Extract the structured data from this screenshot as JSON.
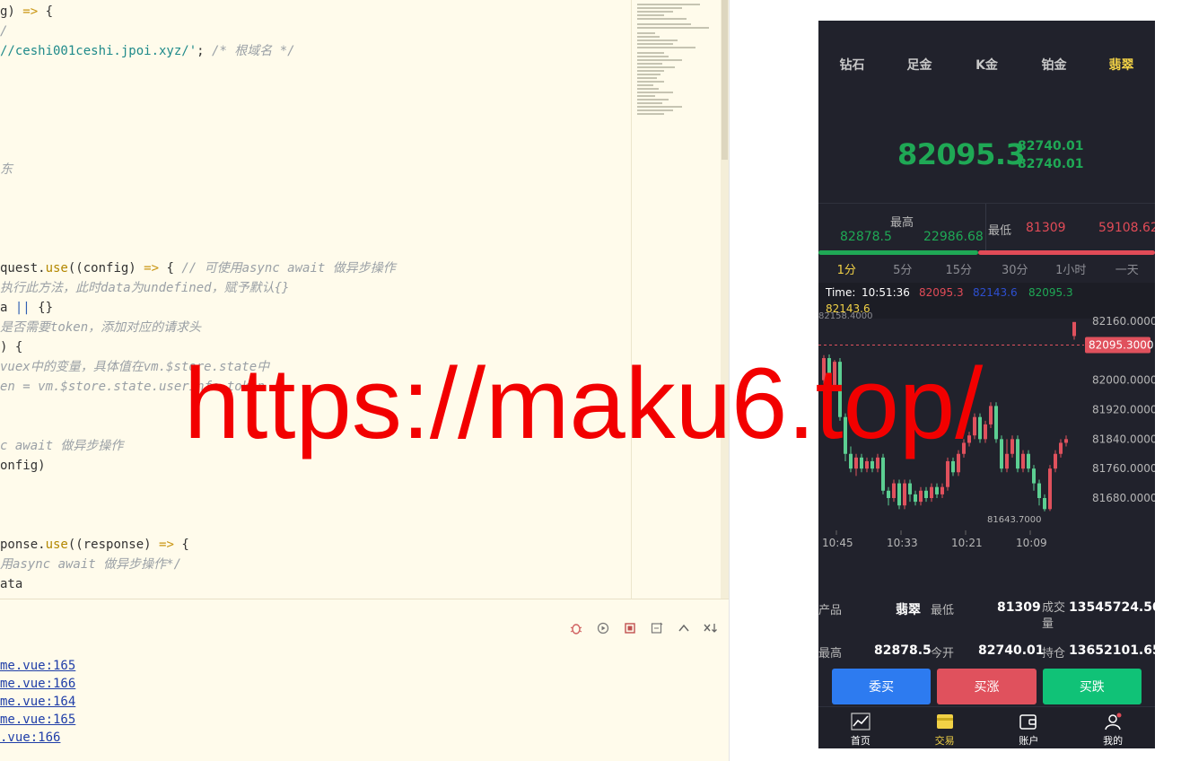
{
  "editor": {
    "lines": [
      {
        "top": 2,
        "parts": [
          [
            "",
            "g) "
          ],
          [
            "k",
            "=>"
          ],
          [
            "",
            " {"
          ]
        ]
      },
      {
        "top": 24,
        "parts": [
          [
            "c",
            "/"
          ]
        ]
      },
      {
        "top": 46,
        "parts": [
          [
            "s",
            "//ceshi001ceshi.jpoi.xyz/'"
          ],
          [
            "",
            "; "
          ],
          [
            "c",
            "/* 根域名 */"
          ]
        ]
      },
      {
        "top": 178,
        "parts": [
          [
            "c",
            "东"
          ]
        ]
      },
      {
        "top": 288,
        "parts": [
          [
            "",
            "quest."
          ],
          [
            "fn",
            "use"
          ],
          [
            "",
            "((config) "
          ],
          [
            "k",
            "=>"
          ],
          [
            "",
            " { "
          ],
          [
            "c",
            "// 可使用async await 做异步操作"
          ]
        ]
      },
      {
        "top": 310,
        "parts": [
          [
            "c",
            "执行此方法，此时data为undefined，赋予默认{}"
          ]
        ]
      },
      {
        "top": 332,
        "parts": [
          [
            "",
            "a "
          ],
          [
            "b",
            "||"
          ],
          [
            "",
            " {}"
          ]
        ]
      },
      {
        "top": 354,
        "parts": [
          [
            "c",
            "是否需要token，添加对应的请求头"
          ]
        ]
      },
      {
        "top": 376,
        "parts": [
          [
            "",
            ") {"
          ]
        ]
      },
      {
        "top": 398,
        "parts": [
          [
            "c",
            "vuex中的变量，具体值在vm.$store.state中"
          ]
        ]
      },
      {
        "top": 420,
        "parts": [
          [
            "c",
            "en = vm.$store.state.userInfo.token"
          ]
        ]
      },
      {
        "top": 486,
        "parts": [
          [
            "c",
            "c await 做异步操作"
          ]
        ]
      },
      {
        "top": 508,
        "parts": [
          [
            "",
            "onfig)"
          ]
        ]
      },
      {
        "top": 596,
        "parts": [
          [
            "",
            "ponse."
          ],
          [
            "fn",
            "use"
          ],
          [
            "",
            "((response) "
          ],
          [
            "k",
            "=>"
          ],
          [
            "",
            " {"
          ]
        ]
      },
      {
        "top": 618,
        "parts": [
          [
            "c",
            "用async await 做异步操作*/"
          ]
        ]
      },
      {
        "top": 640,
        "parts": [
          [
            "",
            "ata"
          ]
        ]
      }
    ]
  },
  "console": {
    "links": [
      {
        "text": "me.vue:165",
        "top": 731
      },
      {
        "text": "me.vue:166",
        "top": 751
      },
      {
        "text": "me.vue:164",
        "top": 771
      },
      {
        "text": "me.vue:165",
        "top": 791
      },
      {
        "text": ".vue:166",
        "top": 811
      }
    ]
  },
  "phone": {
    "tabs": [
      "钻石",
      "足金",
      "K金",
      "铂金",
      "翡翠"
    ],
    "active_tab": 4,
    "price": "82095.3",
    "price_sub1": "82740.01",
    "price_sub2": "82740.01",
    "high_label": "最高",
    "high_v1": "82878.5",
    "high_v2": "22986.68",
    "low_label": "最低",
    "low_v1": "81309",
    "low_v2": "59108.62",
    "periods": [
      "1分",
      "5分",
      "15分",
      "30分",
      "1小时",
      "一天"
    ],
    "active_period": 0,
    "kinfo": {
      "time_label": "Time:",
      "time": "10:51:36",
      "v1": "82095.3",
      "v2": "82143.6",
      "v3": "82095.3",
      "v4": "82143.6"
    },
    "detail": {
      "product_label": "产品",
      "product_value": "翡翠",
      "low_label": "最低",
      "low_value": "81309",
      "volume_label": "成交量",
      "volume_value": "13545724.50",
      "high_label": "最高",
      "high_value": "82878.5",
      "open_label": "今开",
      "open_value": "82740.01",
      "hold_label": "持仓",
      "hold_value": "13652101.65"
    },
    "buttons": {
      "buy": "委买",
      "up": "买涨",
      "down": "买跌"
    },
    "nav": [
      "首页",
      "交易",
      "账户",
      "我的"
    ],
    "active_nav": 1
  },
  "chart_data": {
    "type": "candlestick",
    "y_ticks": [
      "82160.0000",
      "82000.0000",
      "81920.0000",
      "81840.0000",
      "81760.0000",
      "81680.0000"
    ],
    "y_tick_values": [
      82160,
      82000,
      81920,
      81840,
      81760,
      81680
    ],
    "x_ticks": [
      "10:45",
      "10:33",
      "10:21",
      "10:09"
    ],
    "current_price_label": "82095.3000",
    "current_price": 82095.3,
    "max_label": "82158.4000",
    "min_label": "81643.7000",
    "candles": [
      [
        82000,
        82060,
        81990,
        82068
      ],
      [
        82060,
        81980,
        81970,
        82070
      ],
      [
        81980,
        82050,
        81975,
        82055
      ],
      [
        82050,
        81900,
        81890,
        82060
      ],
      [
        81900,
        81800,
        81780,
        81910
      ],
      [
        81800,
        81760,
        81750,
        81820
      ],
      [
        81760,
        81790,
        81740,
        81800
      ],
      [
        81790,
        81760,
        81750,
        81800
      ],
      [
        81760,
        81780,
        81750,
        81790
      ],
      [
        81780,
        81760,
        81750,
        81790
      ],
      [
        81760,
        81790,
        81750,
        81800
      ],
      [
        81790,
        81700,
        81690,
        81800
      ],
      [
        81700,
        81680,
        81660,
        81710
      ],
      [
        81680,
        81720,
        81670,
        81730
      ],
      [
        81720,
        81660,
        81650,
        81730
      ],
      [
        81660,
        81720,
        81650,
        81730
      ],
      [
        81720,
        81690,
        81670,
        81730
      ],
      [
        81690,
        81670,
        81660,
        81700
      ],
      [
        81670,
        81700,
        81660,
        81710
      ],
      [
        81700,
        81680,
        81670,
        81710
      ],
      [
        81680,
        81710,
        81670,
        81720
      ],
      [
        81710,
        81690,
        81680,
        81720
      ],
      [
        81690,
        81710,
        81680,
        81720
      ],
      [
        81710,
        81780,
        81700,
        81790
      ],
      [
        81780,
        81750,
        81740,
        81790
      ],
      [
        81750,
        81800,
        81740,
        81810
      ],
      [
        81800,
        81830,
        81790,
        81840
      ],
      [
        81830,
        81850,
        81820,
        81860
      ],
      [
        81850,
        81900,
        81840,
        81910
      ],
      [
        81900,
        81840,
        81830,
        81910
      ],
      [
        81840,
        81880,
        81830,
        81890
      ],
      [
        81880,
        81930,
        81870,
        81940
      ],
      [
        81930,
        81840,
        81830,
        81940
      ],
      [
        81840,
        81760,
        81750,
        81850
      ],
      [
        81760,
        81800,
        81750,
        81840
      ],
      [
        81800,
        81840,
        81790,
        81850
      ],
      [
        81840,
        81760,
        81750,
        81850
      ],
      [
        81760,
        81800,
        81750,
        81810
      ],
      [
        81800,
        81760,
        81750,
        81810
      ],
      [
        81760,
        81720,
        81700,
        81770
      ],
      [
        81720,
        81680,
        81660,
        81730
      ],
      [
        81680,
        81650,
        81644,
        81690
      ],
      [
        81650,
        81760,
        81645,
        81770
      ],
      [
        81760,
        81800,
        81750,
        81810
      ],
      [
        81800,
        81830,
        81790,
        81840
      ],
      [
        81830,
        81840,
        81820,
        81850
      ],
      [
        82120,
        82158,
        82110,
        82158
      ]
    ]
  },
  "watermark": "https://maku6.top/"
}
